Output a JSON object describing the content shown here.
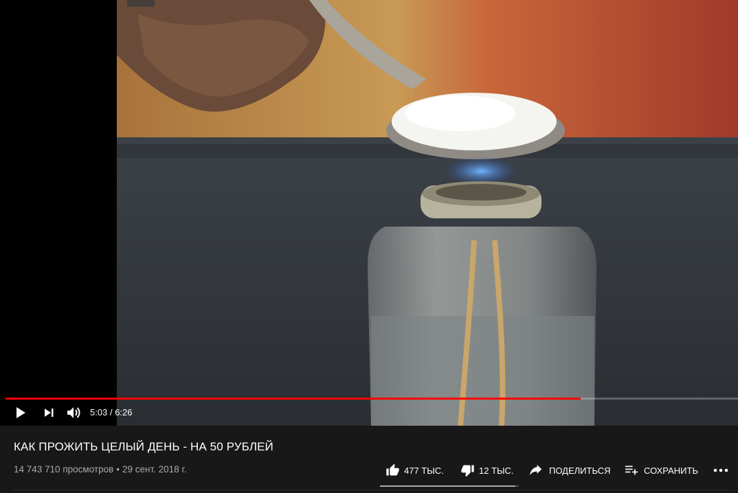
{
  "player": {
    "progress_fraction": 0.785,
    "current_time": "5:03",
    "duration": "6:26",
    "time_separator": "/",
    "progress_color": "#ff0000"
  },
  "controls": {
    "play_icon": "play-icon",
    "next_icon": "next-icon",
    "volume_icon": "volume-icon"
  },
  "video": {
    "title": "КАК ПРОЖИТЬ ЦЕЛЫЙ ДЕНЬ - НА 50 РУБЛЕЙ",
    "views": "14 743 710 просмотров",
    "date": "29 сент. 2018 г.",
    "dot": "•"
  },
  "actions": {
    "like_count": "477 ТЫС.",
    "dislike_count": "12 ТЫС.",
    "share_label": "ПОДЕЛИТЬСЯ",
    "save_label": "СОХРАНИТЬ",
    "more_icon": "more-icon"
  },
  "sentiment": {
    "like_fraction": 0.975
  }
}
